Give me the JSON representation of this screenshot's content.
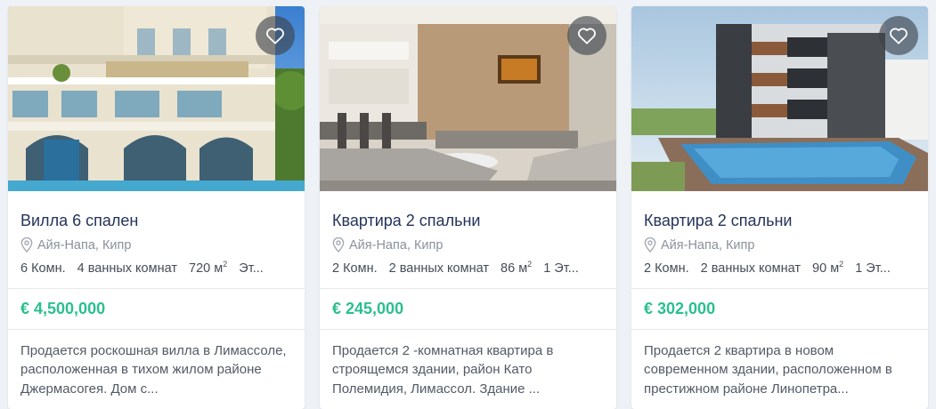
{
  "listings": [
    {
      "title": "Вилла 6 спален",
      "location": "Айя-Напа, Кипр",
      "rooms": "6 Комн.",
      "bathrooms": "4 ванных комнат",
      "area": "720 м",
      "area_sup": "2",
      "floor": "Эт...",
      "price": "€ 4,500,000",
      "description": "Продается роскошная вилла в Лимассоле, расположенная в тихом жилом районе Джермасогея. Дом с..."
    },
    {
      "title": "Квартира 2 спальни",
      "location": "Айя-Напа, Кипр",
      "rooms": "2 Комн.",
      "bathrooms": "2 ванных комнат",
      "area": "86 м",
      "area_sup": "2",
      "floor": "1 Эт...",
      "price": "€ 245,000",
      "description": "Продается 2 -комнатная квартира в строящемся здании, район Като Полемидия, Лимассол. Здание ..."
    },
    {
      "title": "Квартира 2 спальни",
      "location": "Айя-Напа, Кипр",
      "rooms": "2 Комн.",
      "bathrooms": "2 ванных комнат",
      "area": "90 м",
      "area_sup": "2",
      "floor": "1 Эт...",
      "price": "€ 302,000",
      "description": "Продается 2 квартира в новом современном здании, расположенном в престижном районе Линопетра..."
    }
  ],
  "icons": {
    "favorite": "heart-icon",
    "location": "map-pin-icon"
  },
  "colors": {
    "price": "#2bbf8f",
    "title": "#24335a"
  }
}
